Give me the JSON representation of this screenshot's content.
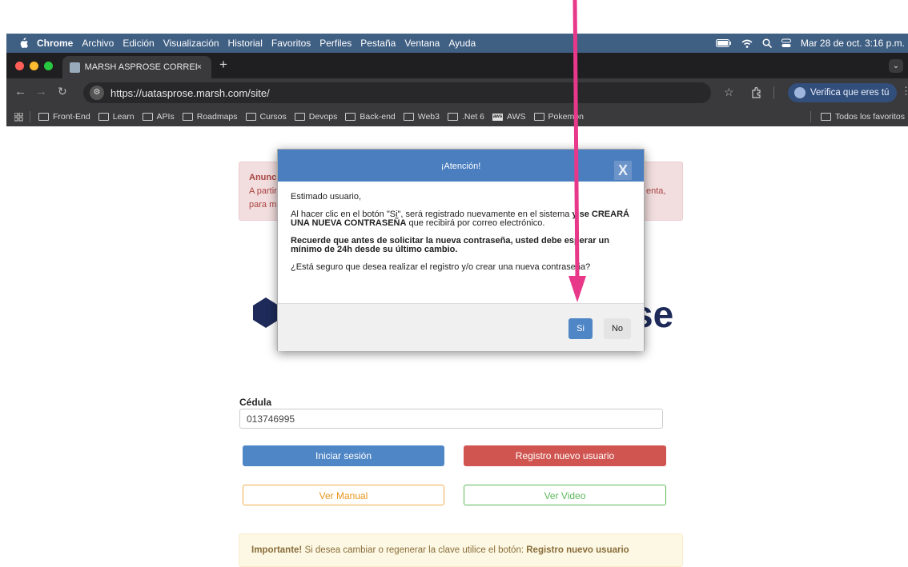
{
  "menubar": {
    "app": "Chrome",
    "items": [
      "Archivo",
      "Edición",
      "Visualización",
      "Historial",
      "Favoritos",
      "Perfiles",
      "Pestaña",
      "Ventana",
      "Ayuda"
    ],
    "datetime": "Mar 28 de oct.  3:16 p.m."
  },
  "tab": {
    "title": "MARSH ASPROSE CORREDO",
    "close": "×",
    "new": "+",
    "menu": "⌄"
  },
  "address": {
    "url": "https://uatasprose.marsh.com/site/",
    "verify": "Verifica que eres tú"
  },
  "bookmarks": {
    "items": [
      "Front-End",
      "Learn",
      "APIs",
      "Roadmaps",
      "Cursos",
      "Devops",
      "Back-end",
      "Web3",
      ".Net 6",
      "AWS",
      "Pokemon"
    ],
    "all": "Todos los favoritos",
    "aws_badge": "aws"
  },
  "anuncio": {
    "title": "Anunci",
    "line1": "A partir",
    "line2": "para m",
    "line1_right": "enta,"
  },
  "logo": {
    "text_fragment": "se",
    "color": "#1e2b5a"
  },
  "form": {
    "cedula_label": "Cédula",
    "cedula_value": "013746995",
    "login": "Iniciar sesión",
    "register": "Registro nuevo usuario",
    "manual": "Ver Manual",
    "video": "Ver Video"
  },
  "importante": {
    "bold": "Importante!",
    "text": " Si desea cambiar o regenerar la clave utilice el botón: ",
    "bold2": "Registro nuevo usuario"
  },
  "modal": {
    "title": "¡Atención!",
    "close": "X",
    "greeting": "Estimado usuario,",
    "p1_a": "Al hacer clic en el botón \"Si\", será registrado nuevamente en el sistema ",
    "p1_b": "y se CREARÁ UNA NUEVA CONTRASEÑA",
    "p1_c": " que recibirá por correo electrónico.",
    "p2": "Recuerde que antes de solicitar la nueva contraseña, usted debe esperar un mínimo de 24h desde su último cambio.",
    "p3": "¿Está seguro que desea realizar el registro y/o crear una nueva contraseña?",
    "yes": "Si",
    "no": "No"
  },
  "colors": {
    "primary": "#4f86c5",
    "danger": "#d05550",
    "arrow": "#e8388a"
  }
}
